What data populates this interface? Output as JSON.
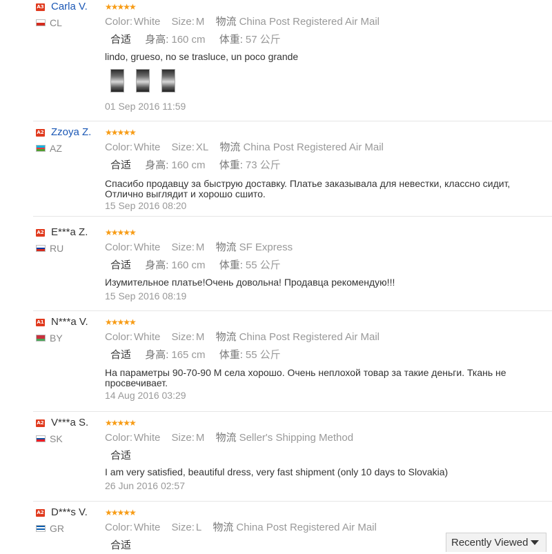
{
  "reviews": [
    {
      "badge": "A3",
      "name": "Carla V.",
      "name_link": true,
      "country": "CL",
      "flag_colors": [
        "#ffffff",
        "#d52b1e"
      ],
      "color_key": "Color:",
      "color": "White",
      "size_key": "Size:",
      "size": "M",
      "logistics_key": "物流",
      "logistics": "China Post Registered Air Mail",
      "fit": "合适",
      "height_key": "身高:",
      "height": "160 cm",
      "weight_key": "体重:",
      "weight": "57",
      "weight_unit": "公斤",
      "text": "lindo, grueso, no se trasluce, un poco grande",
      "photos": 3,
      "date": "01 Sep 2016 11:59"
    },
    {
      "badge": "A2",
      "name": "Zzoya Z.",
      "name_link": true,
      "country": "AZ",
      "flag_colors": [
        "#00b5e2",
        "#ef3340",
        "#509e2f"
      ],
      "color_key": "Color:",
      "color": "White",
      "size_key": "Size:",
      "size": "XL",
      "logistics_key": "物流",
      "logistics": "China Post Registered Air Mail",
      "fit": "合适",
      "height_key": "身高:",
      "height": "160 cm",
      "weight_key": "体重:",
      "weight": "73",
      "weight_unit": "公斤",
      "text": "Спасибо продавцу за быструю доставку. Платье заказывала для невестки, классно сидит, Отлично выглядит и хорошо сшито.",
      "date": "15 Sep 2016 08:20"
    },
    {
      "badge": "A2",
      "name": "E***a Z.",
      "name_link": false,
      "country": "RU",
      "flag_colors": [
        "#ffffff",
        "#0039a6",
        "#d52b1e"
      ],
      "color_key": "Color:",
      "color": "White",
      "size_key": "Size:",
      "size": "M",
      "logistics_key": "物流",
      "logistics": "SF Express",
      "fit": "合适",
      "height_key": "身高:",
      "height": "160 cm",
      "weight_key": "体重:",
      "weight": "55",
      "weight_unit": "公斤",
      "text": "Изумительное платье!Очень довольна! Продавца рекомендую!!!",
      "date": "15 Sep 2016 08:19"
    },
    {
      "badge": "A1",
      "name": "N***a V.",
      "name_link": false,
      "country": "BY",
      "flag_colors": [
        "#c8313e",
        "#c8313e",
        "#4aa657"
      ],
      "color_key": "Color:",
      "color": "White",
      "size_key": "Size:",
      "size": "M",
      "logistics_key": "物流",
      "logistics": "China Post Registered Air Mail",
      "fit": "合适",
      "height_key": "身高:",
      "height": "165 cm",
      "weight_key": "体重:",
      "weight": "55",
      "weight_unit": "公斤",
      "text": "На параметры 90-70-90 М села хорошо. Очень неплохой товар за такие деньги. Ткань не просвечивает.",
      "date": "14 Aug 2016 03:29"
    },
    {
      "badge": "A2",
      "name": "V***a S.",
      "name_link": false,
      "country": "SK",
      "flag_colors": [
        "#ffffff",
        "#0b4ea2",
        "#ee1c25"
      ],
      "color_key": "Color:",
      "color": "White",
      "size_key": "Size:",
      "size": "M",
      "logistics_key": "物流",
      "logistics": "Seller's Shipping Method",
      "fit": "合适",
      "text": "I am very satisfied, beautiful dress, very fast shipment (only 10 days to Slovakia)",
      "date": "26 Jun 2016 02:57"
    },
    {
      "badge": "A2",
      "name": "D***s V.",
      "name_link": false,
      "country": "GR",
      "flag_colors": [
        "#0d5eaf",
        "#ffffff",
        "#0d5eaf",
        "#ffffff"
      ],
      "color_key": "Color:",
      "color": "White",
      "size_key": "Size:",
      "size": "L",
      "logistics_key": "物流",
      "logistics": "China Post Registered Air Mail",
      "fit": "合适"
    }
  ],
  "recently_viewed": {
    "label": "Recently Viewed"
  },
  "colors": {
    "accent_star": "#f79c16",
    "link": "#1a57b5",
    "badge": "#e03a1e"
  }
}
